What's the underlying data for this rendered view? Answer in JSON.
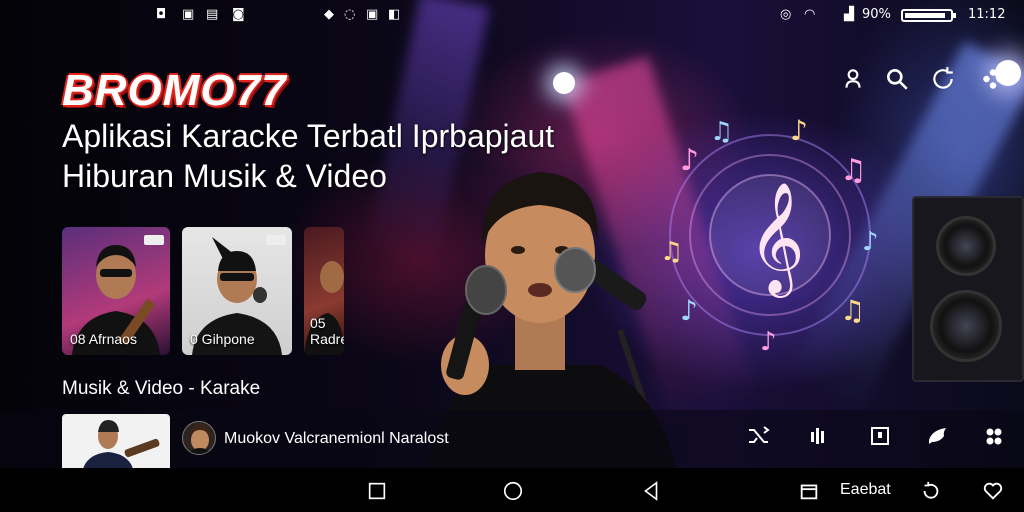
{
  "app": {
    "brand": "BROMO77",
    "subtitle_line1": "Aplikasi Karacke Terbatl Iprbapjaut",
    "subtitle_line2": "Hiburan Musik & Video"
  },
  "status_bar": {
    "battery_percent": "90%",
    "battery_level": 0.9,
    "time": "11:12"
  },
  "top_actions": [
    {
      "name": "profile-icon"
    },
    {
      "name": "search-icon"
    },
    {
      "name": "refresh-icon"
    },
    {
      "name": "menu-icon"
    }
  ],
  "thumbnails": [
    {
      "label": "08 Afrnaos"
    },
    {
      "label": "0 Gihpone"
    },
    {
      "label": "05 Radre"
    }
  ],
  "section": {
    "title": "Musik & Video - Karake"
  },
  "player": {
    "track_title": "Muokov Valcranemionl Naralost"
  },
  "nav": {
    "extra_label": "Eaebat"
  },
  "colors": {
    "brand_red": "#e2261e",
    "background": "#05040c",
    "accent_purple": "#7a4cff"
  }
}
